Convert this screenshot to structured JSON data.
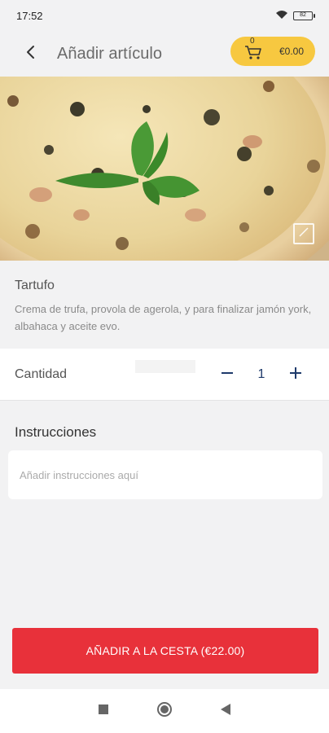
{
  "status_bar": {
    "time": "17:52",
    "battery": "82"
  },
  "header": {
    "title": "Añadir artículo",
    "cart_count": "0",
    "cart_total": "€0.00"
  },
  "product": {
    "image_icon": "pizza-photo",
    "name": "Tartufo",
    "description": "Crema de trufa, provola de agerola, y para finalizar jamón york, albahaca y aceite evo."
  },
  "quantity": {
    "label": "Cantidad",
    "value": "1"
  },
  "instructions": {
    "title": "Instrucciones",
    "placeholder": "Añadir instrucciones aquí",
    "value": ""
  },
  "add_button": {
    "label": "AÑADIR A LA CESTA (€22.00)"
  },
  "colors": {
    "accent": "#e8313a",
    "cart_pill": "#f7c840",
    "quantity_text": "#1e3a6b"
  },
  "nav": {
    "icons": [
      "square-icon",
      "circle-icon",
      "triangle-back-icon"
    ]
  }
}
